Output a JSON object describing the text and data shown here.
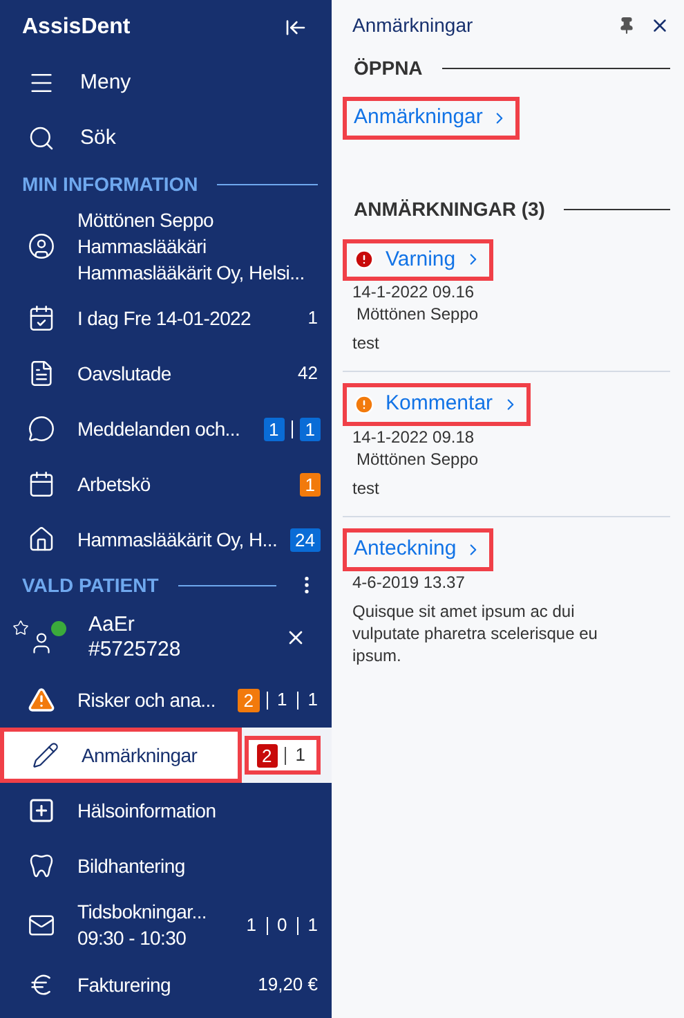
{
  "sidebar": {
    "title": "AssisDent",
    "top_items": [
      {
        "label": "Meny"
      },
      {
        "label": "Sök"
      }
    ],
    "sections": [
      {
        "title": "MIN INFORMATION",
        "items": [
          {
            "lines": [
              "Möttönen Seppo",
              "Hammaslääkäri",
              "Hammaslääkärit Oy, Helsi..."
            ],
            "selected": false,
            "highlighted": false
          },
          {
            "lines": [
              "I dag Fre 14-01-2022"
            ],
            "selected": false,
            "highlighted": false,
            "counts": [
              {
                "text": "1"
              }
            ]
          },
          {
            "lines": [
              "Oavslutade"
            ],
            "selected": false,
            "highlighted": false,
            "counts": [
              {
                "text": "42"
              }
            ]
          },
          {
            "lines": [
              "Meddelanden och..."
            ],
            "selected": false,
            "highlighted": false,
            "counts": [
              {
                "text": "1",
                "color": "#0a6cd6"
              },
              {
                "text": "1",
                "color": "#0a6cd6"
              }
            ]
          },
          {
            "lines": [
              "Arbetskö"
            ],
            "selected": false,
            "highlighted": false,
            "counts": [
              {
                "text": "1",
                "color": "#f27a0c"
              }
            ]
          },
          {
            "lines": [
              "Hammaslääkärit Oy, H..."
            ],
            "selected": false,
            "highlighted": false,
            "counts": [
              {
                "text": "24",
                "color": "#0a6cd6"
              }
            ]
          }
        ]
      },
      {
        "title": "VALD PATIENT",
        "patient": {
          "name": "AaEr",
          "number": "#5725728",
          "color": "#3bab3b"
        },
        "items": [
          {
            "lines": [
              "Risker och ana..."
            ],
            "selected": false,
            "highlighted": false,
            "counts": [
              {
                "text": "2",
                "color": "#f27a0c"
              },
              {
                "text": "1"
              },
              {
                "text": "1"
              }
            ]
          },
          {
            "lines": [
              "Anmärkningar"
            ],
            "selected": true,
            "highlighted": true,
            "counts_highlighted": true,
            "counts": [
              {
                "text": "2",
                "color": "#c80a0a"
              },
              {
                "text": "1"
              }
            ]
          },
          {
            "lines": [
              "Hälsoinformation"
            ],
            "selected": false,
            "highlighted": false
          },
          {
            "lines": [
              "Bildhantering"
            ],
            "selected": false,
            "highlighted": false
          },
          {
            "lines": [
              "Tidsbokningar...",
              "09:30 - 10:30"
            ],
            "selected": false,
            "highlighted": false,
            "counts": [
              {
                "text": "1"
              },
              {
                "text": "0"
              },
              {
                "text": "1"
              }
            ]
          },
          {
            "lines": [
              "Fakturering"
            ],
            "selected": false,
            "highlighted": false,
            "counts": [
              {
                "text": "19,20 €"
              }
            ]
          }
        ]
      }
    ]
  },
  "panel": {
    "title": "Anmärkningar",
    "open_section": {
      "title": "ÖPPNA",
      "link": {
        "label": "Anmärkningar",
        "highlighted": true
      }
    },
    "notes_section": {
      "title": "ANMÄRKNINGAR (3)",
      "notes": [
        {
          "kind": "warning",
          "title": "Varning",
          "highlighted": true,
          "date": "14-1-2022 09.16",
          "author": "Möttönen Seppo",
          "text": "test"
        },
        {
          "kind": "comment",
          "title": "Kommentar",
          "highlighted": true,
          "date": "14-1-2022 09.18",
          "author": "Möttönen Seppo",
          "text": "test"
        },
        {
          "kind": "note",
          "title": "Anteckning",
          "highlighted": true,
          "date": "4-6-2019 13.37",
          "text": "Quisque sit amet ipsum ac dui vulputate pharetra scelerisque eu ipsum."
        }
      ]
    }
  }
}
